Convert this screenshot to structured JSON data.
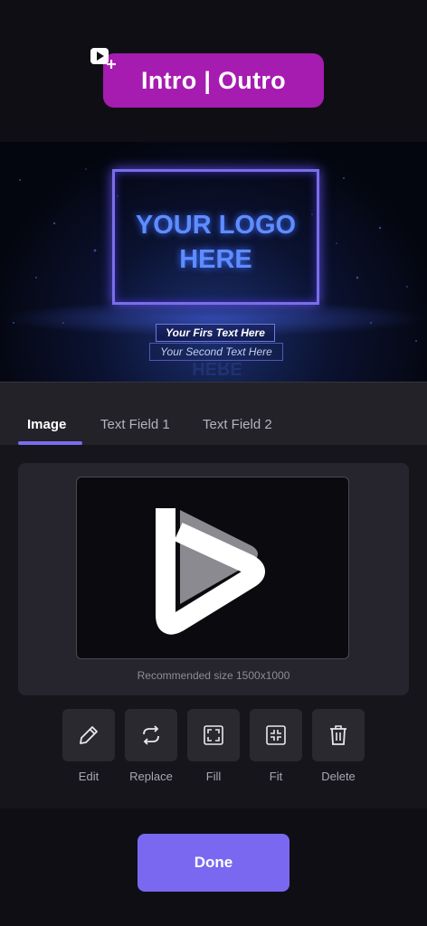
{
  "header": {
    "title": "Intro | Outro",
    "icon": "video-plus-icon"
  },
  "preview": {
    "logo_line1": "YOUR LOGO",
    "logo_line2": "HERE",
    "text_field_1": "Your Firs Text Here",
    "text_field_2": "Your Second Text Here",
    "reflection": "HERE"
  },
  "tabs": [
    {
      "label": "Image",
      "active": true
    },
    {
      "label": "Text Field 1",
      "active": false
    },
    {
      "label": "Text Field 2",
      "active": false
    }
  ],
  "image_card": {
    "hint": "Recommended size 1500x1000",
    "icon": "play-logo-icon"
  },
  "tools": [
    {
      "label": "Edit",
      "icon": "pencil-icon"
    },
    {
      "label": "Replace",
      "icon": "replace-icon"
    },
    {
      "label": "Fill",
      "icon": "fill-icon"
    },
    {
      "label": "Fit",
      "icon": "fit-icon"
    },
    {
      "label": "Delete",
      "icon": "trash-icon"
    }
  ],
  "footer": {
    "done_label": "Done"
  },
  "colors": {
    "title_bg": "#a61bb0",
    "accent": "#7a68f0",
    "background": "#0f0e14"
  }
}
